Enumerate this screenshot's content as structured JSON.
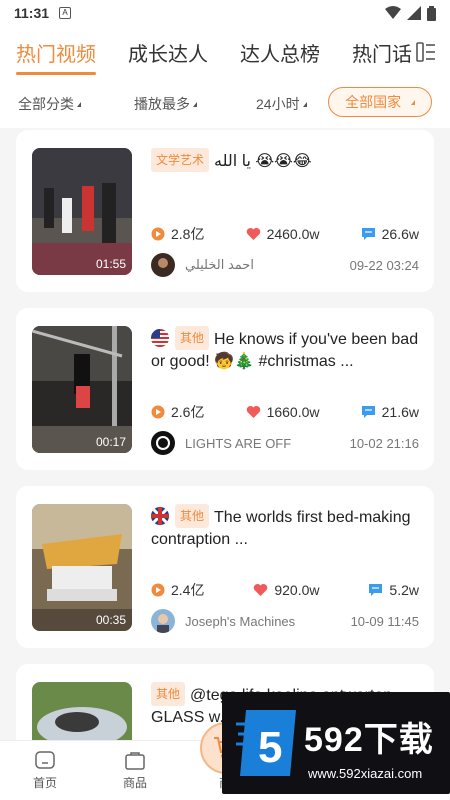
{
  "status_bar": {
    "time": "11:31",
    "sim_label": "A"
  },
  "tabs": [
    {
      "label": "热门视频",
      "active": true
    },
    {
      "label": "成长达人",
      "active": false
    },
    {
      "label": "达人总榜",
      "active": false
    },
    {
      "label": "热门话",
      "active": false
    }
  ],
  "filters": {
    "category": "全部分类",
    "sort": "播放最多",
    "period": "24小时",
    "country": "全部国家"
  },
  "cards": [
    {
      "badge": "文学艺术",
      "flag": "",
      "title": "يا الله 😭😭😂",
      "duration": "01:55",
      "plays": "2.8亿",
      "likes": "2460.0w",
      "comments": "26.6w",
      "author": "احمد الخليلي",
      "time": "09-22 03:24"
    },
    {
      "badge": "其他",
      "flag": "us",
      "title": "He knows if you've been bad or good! 🧒🎄 #christmas ...",
      "duration": "00:17",
      "plays": "2.6亿",
      "likes": "1660.0w",
      "comments": "21.6w",
      "author": "LIGHTS ARE OFF",
      "time": "10-02 21:16"
    },
    {
      "badge": "其他",
      "flag": "gb",
      "title": "The worlds first bed-making contraption ...",
      "duration": "00:35",
      "plays": "2.4亿",
      "likes": "920.0w",
      "comments": "5.2w",
      "author": "Joseph's Machines",
      "time": "10-09 11:45"
    },
    {
      "badge": "其他",
      "flag": "",
      "title": "@tega.life koalino antworten GLASS w..."
    }
  ],
  "bottom_nav": [
    {
      "label": "首页",
      "icon": "home-icon"
    },
    {
      "label": "商品",
      "icon": "bag-icon"
    },
    {
      "label": "商",
      "icon": "cart-icon"
    }
  ],
  "watermark": {
    "text": "592下载",
    "url": "www.592xiazai.com",
    "digit": "5"
  },
  "colors": {
    "accent": "#f08a3c",
    "badge_bg": "#fde9dc",
    "heart": "#f05a5a",
    "comment": "#3a9bf0"
  }
}
